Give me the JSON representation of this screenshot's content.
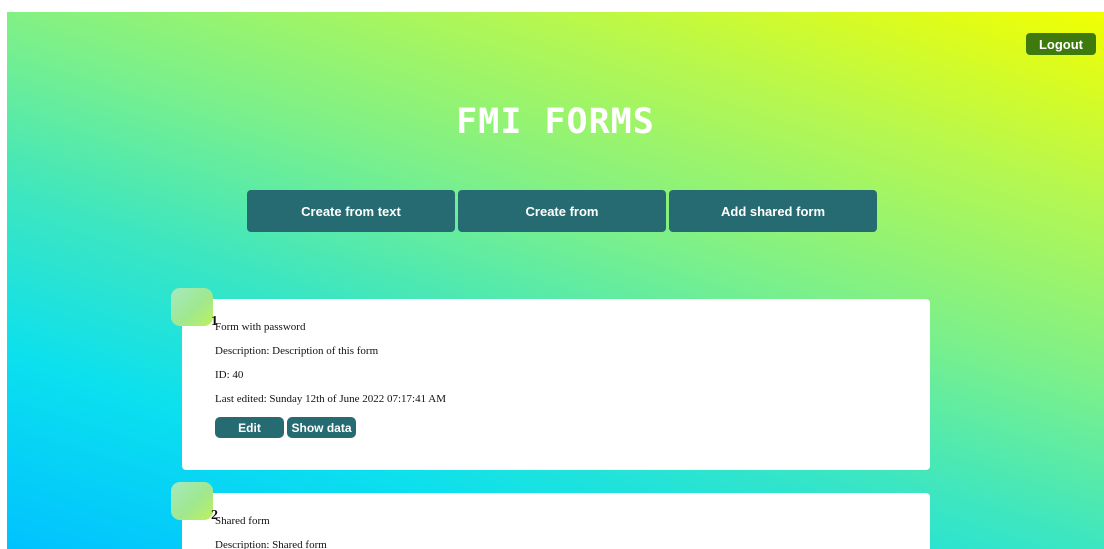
{
  "header": {
    "logout_label": "Logout",
    "title": "FMI FORMS"
  },
  "actions": {
    "create_from_text": "Create from text",
    "create_from": "Create from",
    "add_shared_form": "Add shared form"
  },
  "forms": [
    {
      "number": "1",
      "name": "Form with password",
      "description": "Description: Description of this form",
      "id": "ID: 40",
      "last_edited": "Last edited: Sunday 12th of June 2022 07:17:41 AM",
      "edit_label": "Edit",
      "show_data_label": "Show data"
    },
    {
      "number": "2",
      "name": "Shared form",
      "description": "Description: Shared form"
    }
  ],
  "colors": {
    "primary_button": "#266b72",
    "logout_button": "#3f7a0c",
    "gradient_start": "#00c2ff",
    "gradient_end": "#f2ff00"
  }
}
